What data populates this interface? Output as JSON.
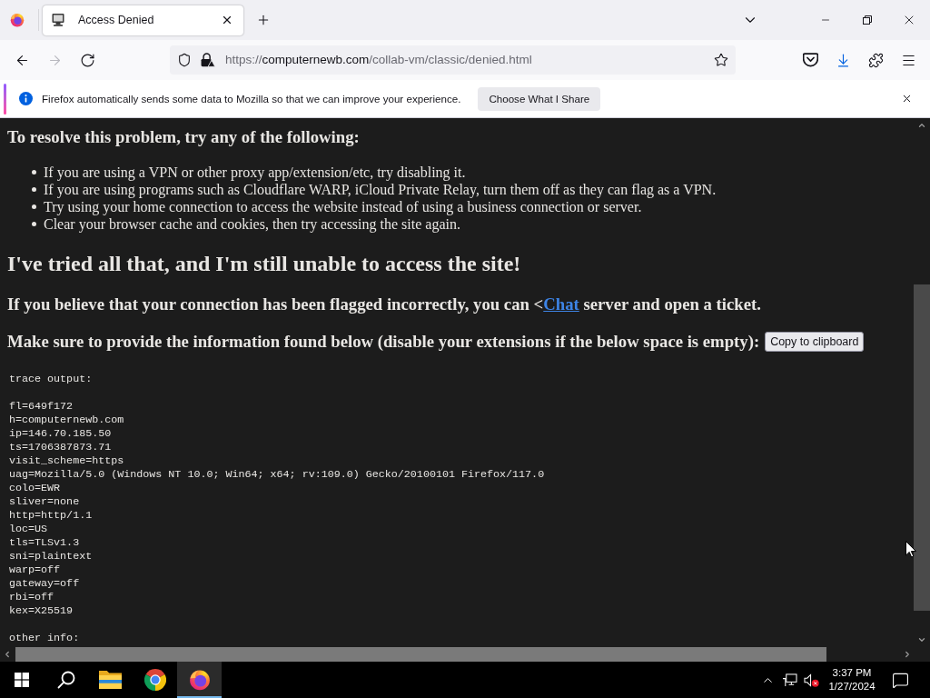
{
  "window": {
    "tabs": [
      {
        "title": "Access Denied",
        "selected": true
      }
    ],
    "nav_buttons": [
      {
        "kind": "back",
        "disabled": false
      },
      {
        "kind": "forward",
        "disabled": true
      },
      {
        "kind": "reload",
        "disabled": false
      }
    ],
    "address": {
      "scheme": "https://",
      "host": "computernewb.com",
      "path": "/collab-vm/classic/denied.html"
    },
    "toolbar_buttons": [
      {
        "kind": "pocket",
        "active": false
      },
      {
        "kind": "downloads",
        "active": true
      },
      {
        "kind": "extensions",
        "active": false
      },
      {
        "kind": "menu",
        "active": false
      }
    ]
  },
  "notification": {
    "message": "Firefox automatically sends some data to Mozilla so that we can improve your experience.",
    "button": "Choose What I Share"
  },
  "page": {
    "heading": "To resolve this problem, try any of the following:",
    "tips": [
      "If you are using a VPN or other proxy app/extension/etc, try disabling it.",
      "If you are using programs such as Cloudflare WARP, iCloud Private Relay, turn them off as they can flag as a VPN.",
      "Try using your home connection to access the website instead of using a business connection or server.",
      "Clear your browser cache and cookies, then try accessing the site again."
    ],
    "subheading": "I've tried all that, and I'm still unable to access the site!",
    "ticket_note": {
      "before": "If you believe that your connection has been flagged incorrectly, you can <",
      "link": "Chat",
      "after": " server and open a ticket."
    },
    "info_note": "Make sure to provide the information found below (disable your extensions if the below space is empty):",
    "copy_button": "Copy to clipboard",
    "trace": {
      "title": "trace output:",
      "lines": [
        "fl=649f172",
        "h=computernewb.com",
        "ip=146.70.185.50",
        "ts=1706387873.71",
        "visit_scheme=https",
        "uag=Mozilla/5.0 (Windows NT 10.0; Win64; x64; rv:109.0) Gecko/20100101 Firefox/117.0",
        "colo=EWR",
        "sliver=none",
        "http=http/1.1",
        "loc=US",
        "tls=TLSv1.3",
        "sni=plaintext",
        "warp=off",
        "gateway=off",
        "rbi=off",
        "kex=X25519"
      ],
      "footer": "other info:"
    }
  },
  "taskbar": {
    "apps": [
      {
        "kind": "search",
        "selected": false
      },
      {
        "kind": "files",
        "selected": false
      },
      {
        "kind": "chrome",
        "selected": false
      },
      {
        "kind": "firefox",
        "selected": true
      }
    ],
    "volume_muted": true,
    "time": "3:37 PM",
    "date": "1/27/2024"
  }
}
